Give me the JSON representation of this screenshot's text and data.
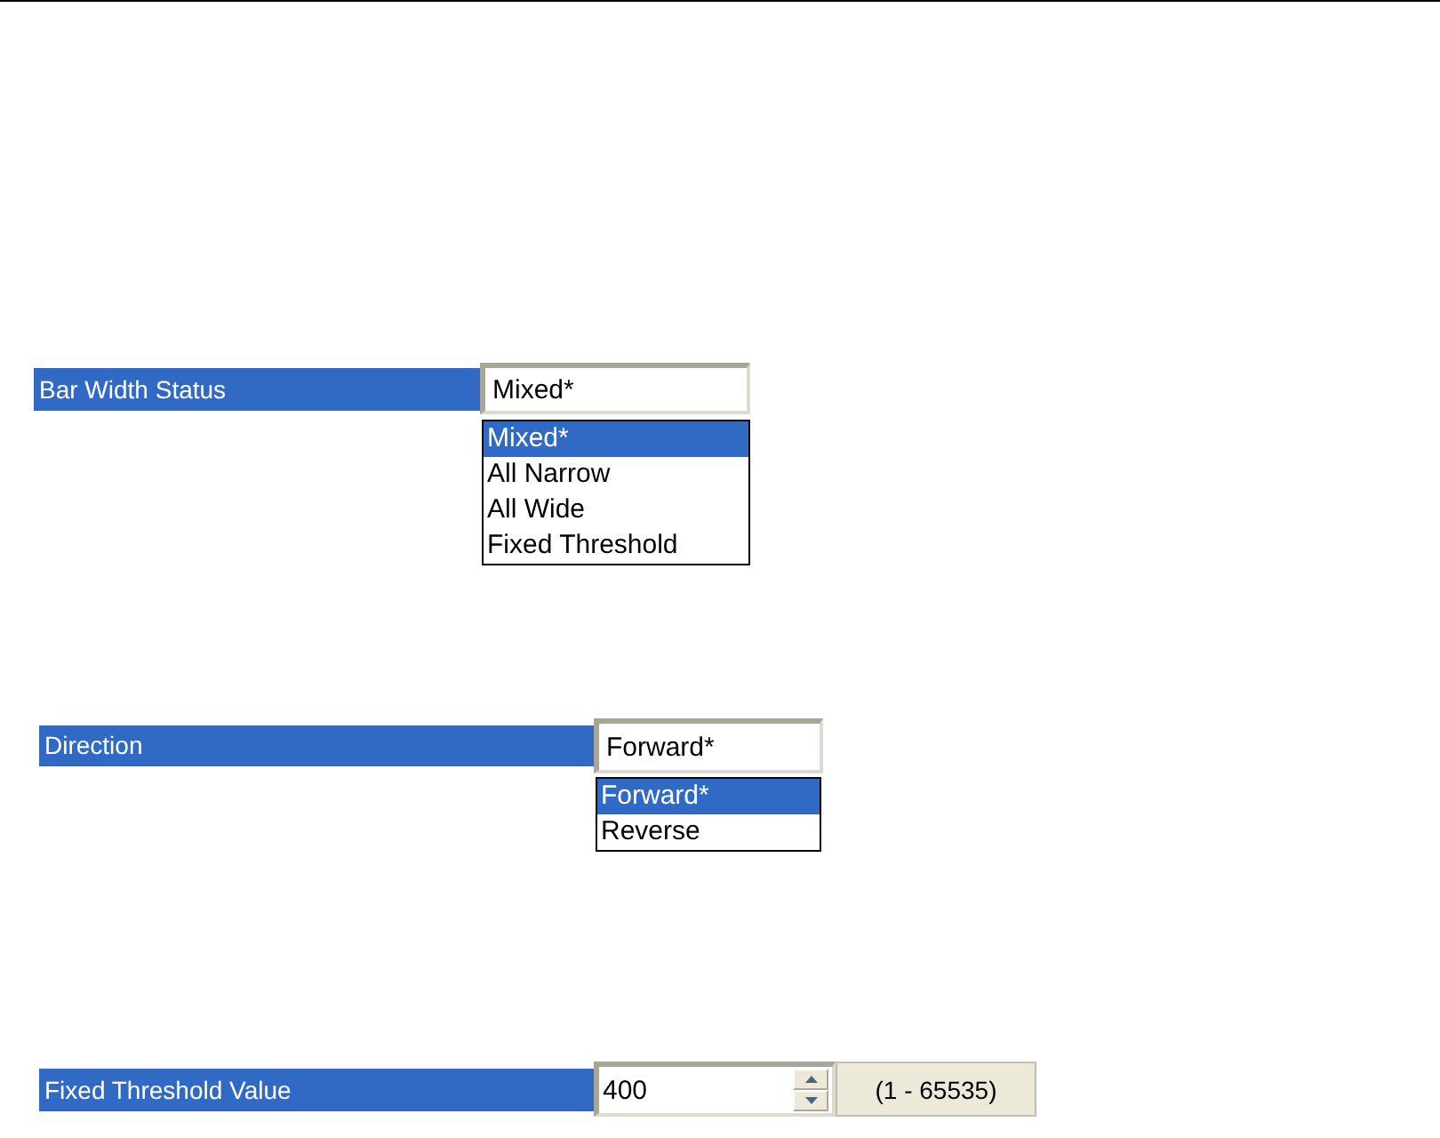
{
  "fields": [
    {
      "kind": "dropdown",
      "label": "Bar Width Status",
      "value": "Mixed*",
      "options": [
        {
          "label": "Mixed*",
          "selected": true
        },
        {
          "label": "All Narrow",
          "selected": false
        },
        {
          "label": "All Wide",
          "selected": false
        },
        {
          "label": "Fixed Threshold",
          "selected": false
        }
      ]
    },
    {
      "kind": "dropdown",
      "label": "Direction",
      "value": "Forward*",
      "options": [
        {
          "label": "Forward*",
          "selected": true
        },
        {
          "label": "Reverse",
          "selected": false
        }
      ]
    },
    {
      "kind": "spinner",
      "label": "Fixed Threshold Value",
      "value": "400",
      "range": "(1 - 65535)"
    }
  ]
}
